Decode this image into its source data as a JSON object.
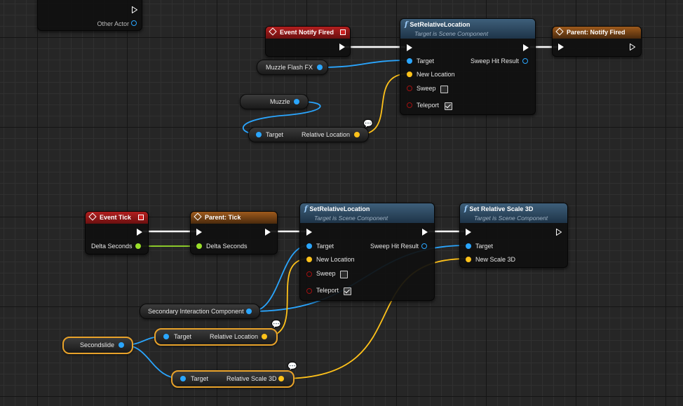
{
  "top_left_node": {
    "other_actor": "Other Actor"
  },
  "event_notify": {
    "title": "Event Notify Fired"
  },
  "set_rel_loc_1": {
    "title": "SetRelativeLocation",
    "subtitle": "Target is Scene Component",
    "target": "Target",
    "new_location": "New Location",
    "sweep": "Sweep",
    "teleport": "Teleport",
    "sweep_hit": "Sweep Hit Result",
    "sweep_checked": false,
    "teleport_checked": true
  },
  "parent_notify": {
    "title": "Parent: Notify Fired"
  },
  "muzzle_flash": {
    "label": "Muzzle Flash FX"
  },
  "muzzle": {
    "label": "Muzzle"
  },
  "get_rel_loc_1": {
    "target": "Target",
    "output": "Relative Location"
  },
  "event_tick": {
    "title": "Event Tick",
    "delta": "Delta Seconds"
  },
  "parent_tick": {
    "title": "Parent: Tick",
    "delta": "Delta Seconds"
  },
  "set_rel_loc_2": {
    "title": "SetRelativeLocation",
    "subtitle": "Target is Scene Component",
    "target": "Target",
    "new_location": "New Location",
    "sweep": "Sweep",
    "teleport": "Teleport",
    "sweep_hit": "Sweep Hit Result",
    "sweep_checked": false,
    "teleport_checked": true
  },
  "set_rel_scale": {
    "title": "Set Relative Scale 3D",
    "subtitle": "Target is Scene Component",
    "target": "Target",
    "new_scale": "New Scale 3D"
  },
  "secondary_comp": {
    "label": "Secondary Interaction Component"
  },
  "secondslide": {
    "label": "Secondslide"
  },
  "get_rel_loc_2": {
    "target": "Target",
    "output": "Relative Location"
  },
  "get_rel_scale": {
    "target": "Target",
    "output": "Relative Scale 3D"
  },
  "colors": {
    "exec": "#ffffff",
    "object_pin": "#2aa6ff",
    "vector_pin": "#ffc21a",
    "float_pin": "#9adf2a",
    "bool_pin": "#a01010",
    "event_header": "#b21e1e",
    "parent_header": "#9e5a1c",
    "function_header": "#3e5f7a",
    "selection": "#e8a22a"
  }
}
